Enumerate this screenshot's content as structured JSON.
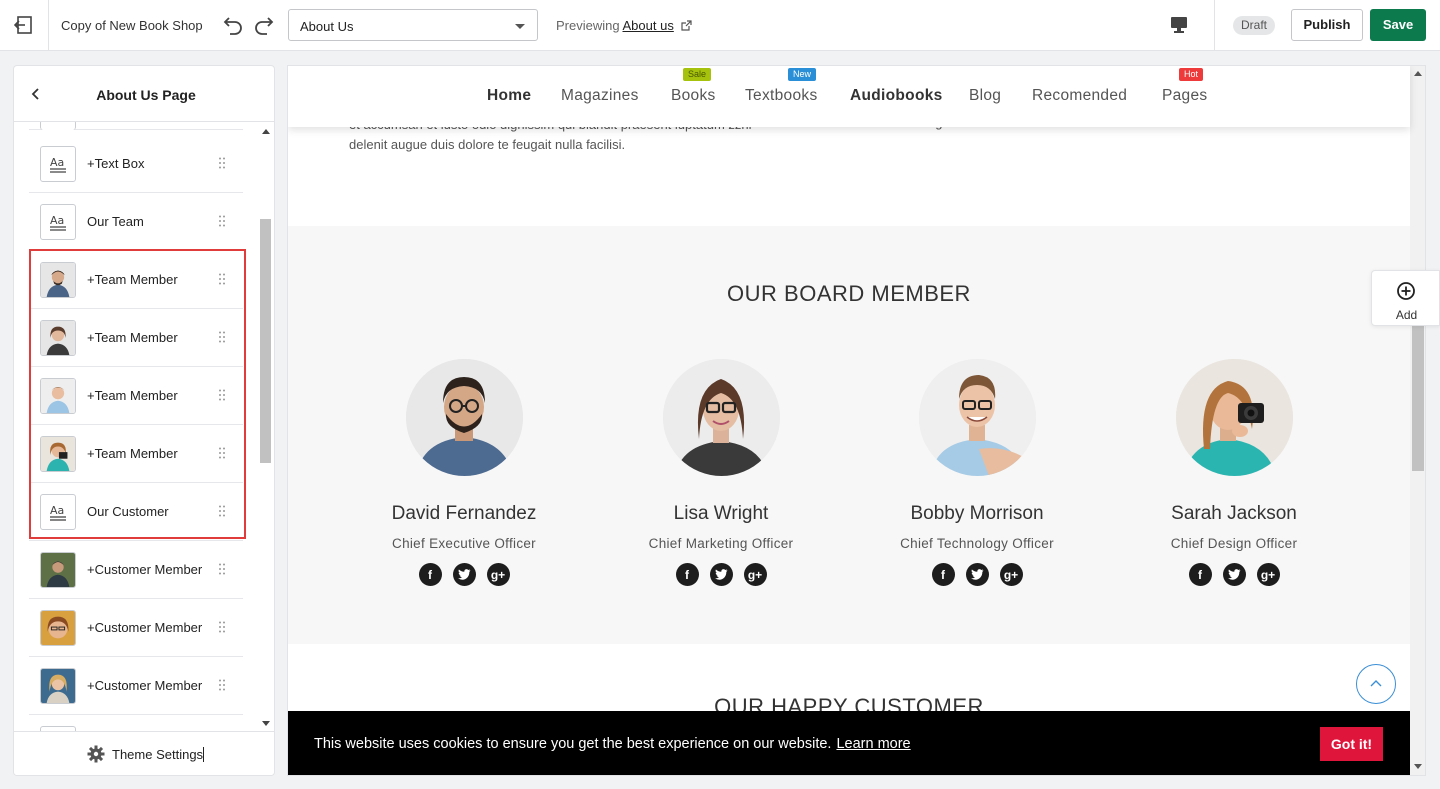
{
  "topbar": {
    "shop_name": "Copy of New Book Shop",
    "page_select": "About Us",
    "previewing_label": "Previewing",
    "previewing_link": "About us",
    "status_badge": "Draft",
    "publish_label": "Publish",
    "save_label": "Save",
    "save_color": "#0d7a4e"
  },
  "left_panel": {
    "title": "About Us Page",
    "items": [
      {
        "label": "+Text Box",
        "icon": "text-block-icon"
      },
      {
        "label": "Our Team",
        "icon": "text-block-icon"
      },
      {
        "label": "+Team Member",
        "icon": "person-avatar"
      },
      {
        "label": "+Team Member",
        "icon": "person-avatar"
      },
      {
        "label": "+Team Member",
        "icon": "person-avatar"
      },
      {
        "label": "+Team Member",
        "icon": "person-avatar"
      },
      {
        "label": "Our Customer",
        "icon": "text-block-icon"
      },
      {
        "label": "+Customer Member",
        "icon": "person-avatar"
      },
      {
        "label": "+Customer Member",
        "icon": "person-avatar"
      },
      {
        "label": "+Customer Member",
        "icon": "person-avatar"
      }
    ],
    "footer_label": "Theme Settings",
    "highlight_color": "#e13c3c"
  },
  "site": {
    "nav": [
      {
        "label": "Home",
        "bold": true
      },
      {
        "label": "Magazines",
        "bold": false
      },
      {
        "label": "Books",
        "bold": false,
        "badge": "Sale",
        "badge_color": "#a6c20c"
      },
      {
        "label": "Textbooks",
        "bold": false,
        "badge": "New",
        "badge_color": "#2a8fd6"
      },
      {
        "label": "Audiobooks",
        "bold": true
      },
      {
        "label": "Blog",
        "bold": false
      },
      {
        "label": "Recomended",
        "bold": false
      },
      {
        "label": "Pages",
        "bold": false,
        "badge": "Hot",
        "badge_color": "#ee3a3a"
      }
    ],
    "intro_line1": "et accumsan et iusto odio dignissim qui blandit praesent luptatum zzril",
    "intro_line2": "delenit augue duis dolore te feugait nulla facilisi.",
    "intro_col2_line1": "dolore te feugait nulla facilisi.",
    "board_title": "OUR BOARD MEMBER",
    "members": [
      {
        "name": "David Fernandez",
        "role": "Chief Executive Officer"
      },
      {
        "name": "Lisa Wright",
        "role": "Chief Marketing Officer"
      },
      {
        "name": "Bobby Morrison",
        "role": "Chief Technology Officer"
      },
      {
        "name": "Sarah Jackson",
        "role": "Chief Design Officer"
      }
    ],
    "happy_title": "OUR HAPPY CUSTOMER",
    "cookie_message": "This website uses cookies to ensure you get the best experience on our website.",
    "cookie_link": "Learn more",
    "cookie_button": "Got it!",
    "cookie_button_color": "#e0153c"
  },
  "add_panel": {
    "label": "Add"
  }
}
